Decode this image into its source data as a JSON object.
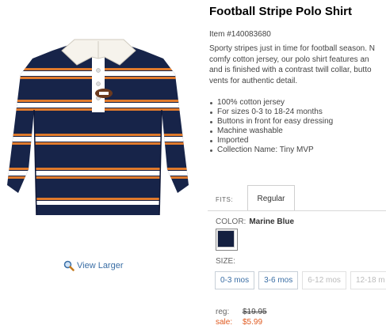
{
  "product": {
    "title": "Football Stripe Polo Shirt",
    "item_number": "Item #140083680",
    "description_lines": [
      "Sporty stripes just in time for football season. N",
      "comfy cotton jersey, our polo shirt features an",
      "and is finished with a contrast twill collar, butto",
      "vents for authentic detail."
    ],
    "features": [
      "100% cotton jersey",
      "For sizes 0-3 to 18-24 months",
      "Buttons in front for easy dressing",
      "Machine washable",
      "Imported",
      "Collection Name: Tiny MVP"
    ]
  },
  "image": {
    "view_larger_label": "View Larger"
  },
  "fits": {
    "label": "FITS:",
    "selected": "Regular"
  },
  "color": {
    "label": "COLOR:",
    "selected": "Marine Blue",
    "swatch_hex": "#142040"
  },
  "size": {
    "label": "SIZE:",
    "options": [
      {
        "label": "0-3 mos",
        "available": true
      },
      {
        "label": "3-6 mos",
        "available": true
      },
      {
        "label": "6-12 mos",
        "available": false
      },
      {
        "label": "12-18 m",
        "available": false
      }
    ]
  },
  "pricing": {
    "reg_label": "reg:",
    "reg_price": "$19.95",
    "sale_label": "sale:",
    "sale_price": "$5.99"
  },
  "colors": {
    "link": "#3a6ea5",
    "sale": "#e0591e",
    "navy": "#142040"
  }
}
